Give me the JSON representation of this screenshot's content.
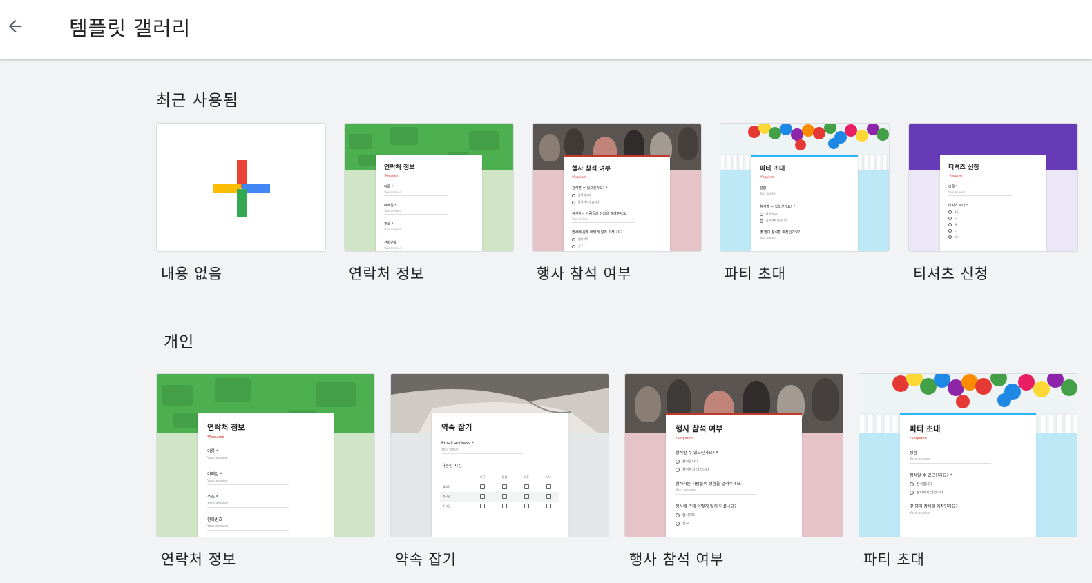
{
  "header": {
    "title": "템플릿 갤러리",
    "back_icon": "arrow-left-icon"
  },
  "sections": {
    "recent": {
      "title": "최근 사용됨"
    },
    "personal": {
      "title": "개인"
    }
  },
  "recent_cards": [
    {
      "label": "내용 없음"
    },
    {
      "label": "연락처 정보",
      "form_title": "연락처 정보"
    },
    {
      "label": "행사 참석 여부",
      "form_title": "행사 참석 여부"
    },
    {
      "label": "파티 초대",
      "form_title": "파티 초대"
    },
    {
      "label": "티셔츠 신청",
      "form_title": "티셔츠 신청"
    }
  ],
  "personal_cards": [
    {
      "label": "연락처 정보",
      "form_title": "연락처 정보"
    },
    {
      "label": "약속 잡기",
      "form_title": "약속 잡기"
    },
    {
      "label": "행사 참석 여부",
      "form_title": "행사 참석 여부"
    },
    {
      "label": "파티 초대",
      "form_title": "파티 초대"
    }
  ],
  "form_text": {
    "required": "*Required",
    "your_answer": "Your answer",
    "your_email": "Your email",
    "contact": {
      "q1": "이름 *",
      "q2": "이메일 *",
      "q3": "주소 *",
      "q4": "전화번호"
    },
    "event": {
      "q1": "참석할 수 있으신가요? *",
      "o1": "참석합니다",
      "o2": "참석하지 않습니다",
      "q2": "참석하는 사람들의 성함을 알려주세요.",
      "q3": "행사에 관해 어떻게 알게 되셨나요?",
      "o3": "웹사이트",
      "o4": "친구"
    },
    "party": {
      "q1": "성함",
      "q2": "참석할 수 있으신가요? *",
      "o1": "참석합니다",
      "o2": "참석하지 않습니다",
      "q3": "몇 명이 참석할 예정인가요?"
    },
    "tshirt": {
      "q1": "이름 *",
      "q2": "티셔츠 사이즈",
      "sizes": [
        "XS",
        "S",
        "M",
        "L",
        "XL"
      ]
    },
    "meeting": {
      "email": "Email address *",
      "q2": "가능한 시간",
      "cols": [
        "오전",
        "점심",
        "오후",
        "저녁"
      ],
      "rows": [
        "월요일",
        "화요일",
        "수요일"
      ]
    }
  },
  "colors": {
    "accent_red": "#ea4335",
    "accent_blue": "#4285f4",
    "accent_yellow": "#fbbc04",
    "accent_green": "#34a853",
    "contact_green": "#4caf50",
    "contact_light": "#cfe5c6",
    "event_pink": "#e5c3c6",
    "party_blue": "#bde9f7",
    "tshirt_purple": "#673ab7",
    "tshirt_light": "#ece7f6"
  }
}
